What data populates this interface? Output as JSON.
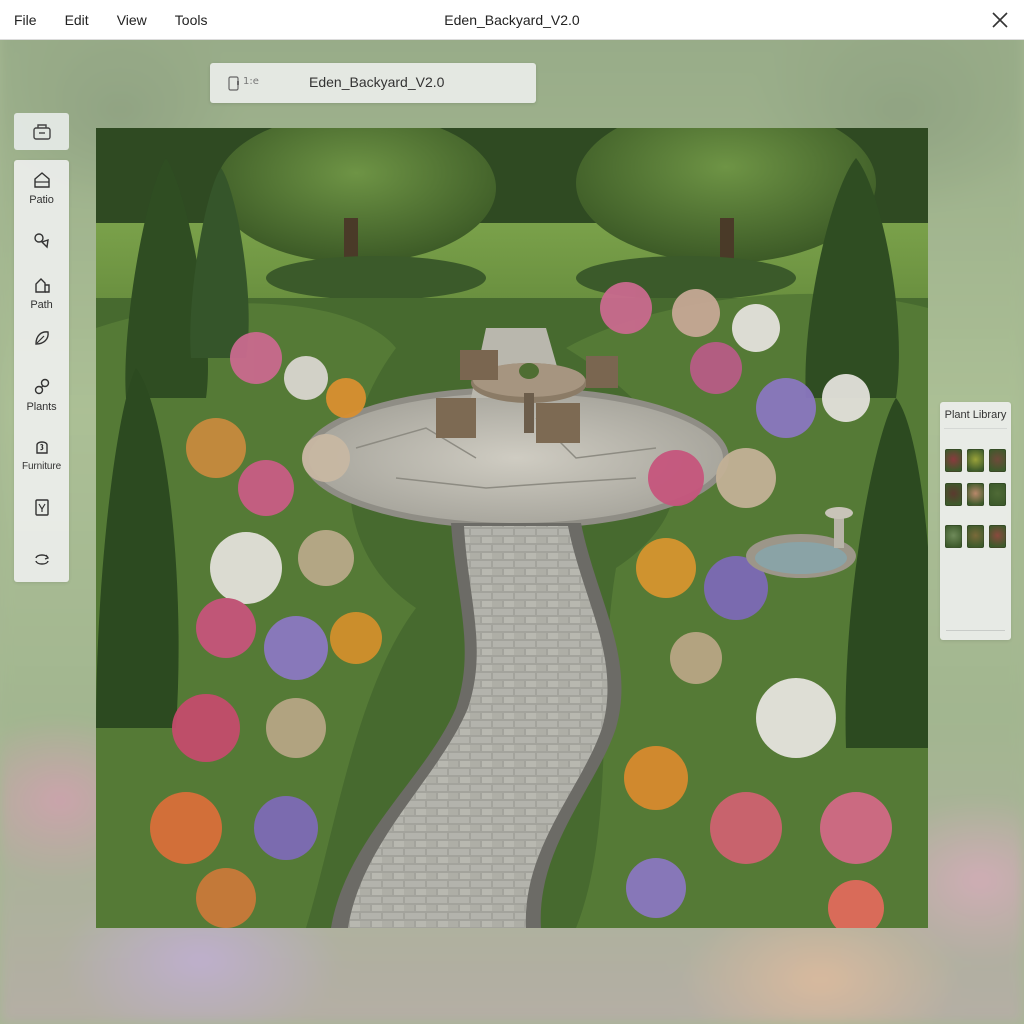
{
  "menubar": {
    "items": [
      "File",
      "Edit",
      "View",
      "Tools"
    ],
    "window_title": "Eden_Backyard_V2.0"
  },
  "doc_tab": {
    "meta": "1:e",
    "name": "Eden_Backyard_V2.0"
  },
  "toolbar": {
    "top_button_icon": "layers-icon",
    "tools": [
      {
        "id": "patio",
        "label": "Patio",
        "icon": "patio-icon"
      },
      {
        "id": "shape",
        "label": "",
        "icon": "shapes-icon"
      },
      {
        "id": "path",
        "label": "Path",
        "icon": "path-icon"
      },
      {
        "id": "leaf",
        "label": "",
        "icon": "leaf-icon"
      },
      {
        "id": "plants",
        "label": "Plants",
        "icon": "plants-icon"
      },
      {
        "id": "furniture",
        "label": "Furniture",
        "icon": "furniture-icon"
      },
      {
        "id": "trash",
        "label": "",
        "icon": "trash-icon"
      },
      {
        "id": "refresh",
        "label": "",
        "icon": "refresh-icon"
      }
    ]
  },
  "library": {
    "title": "Plant Library",
    "thumbnails": [
      {
        "name": "red-roses",
        "color": "#8a3a3e"
      },
      {
        "name": "yellow-marigold",
        "color": "#9aa23a"
      },
      {
        "name": "red-geranium",
        "color": "#6f4a3a"
      },
      {
        "name": "burgundy-heuchera",
        "color": "#5b3a2e"
      },
      {
        "name": "peach-begonia",
        "color": "#b8886a"
      },
      {
        "name": "green-fern",
        "color": "#4f6a36"
      },
      {
        "name": "white-hydrangea",
        "color": "#6f8a5a"
      },
      {
        "name": "orange-lily",
        "color": "#7a6a3a"
      },
      {
        "name": "red-salvia",
        "color": "#8a4a3e"
      }
    ]
  },
  "colors": {
    "menubar_bg": "#ffffff",
    "panel_bg": "#eef0ee",
    "lawn": "#5c7d3c",
    "paving": "#a9a9a2"
  }
}
